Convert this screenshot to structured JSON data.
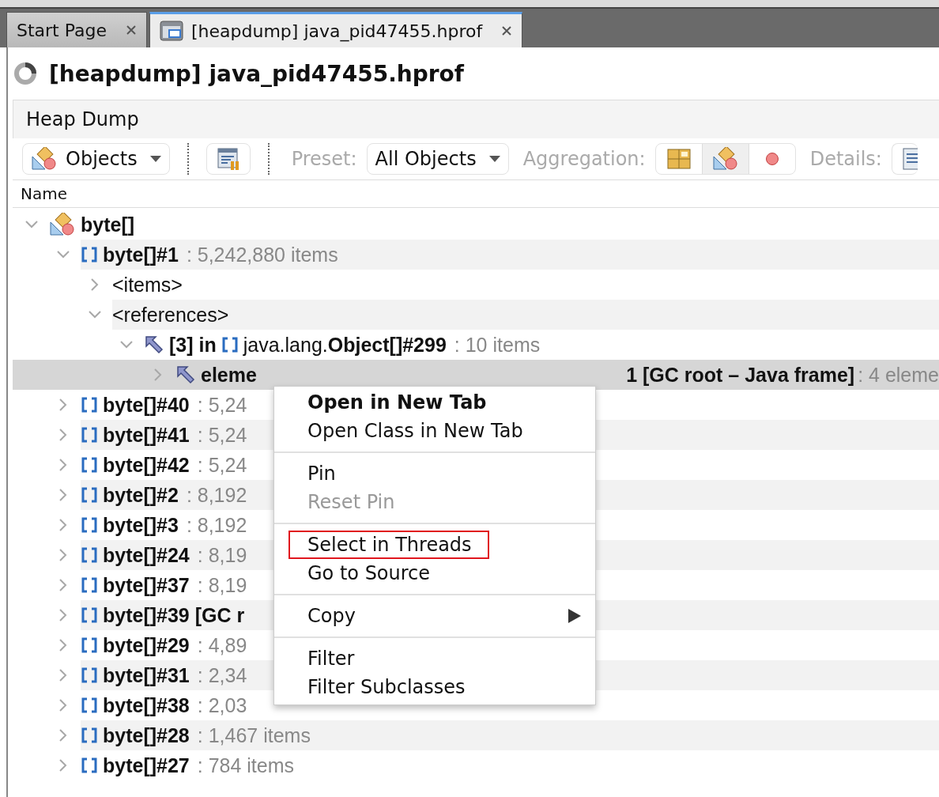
{
  "tabs": [
    {
      "label": "Start Page",
      "kind": "page",
      "selected": false
    },
    {
      "label": "[heapdump] java_pid47455.hprof",
      "kind": "heapdump",
      "selected": true
    }
  ],
  "title": "[heapdump] java_pid47455.hprof",
  "section": "Heap Dump",
  "toolbar": {
    "view": "Objects",
    "preset_label": "Preset:",
    "preset": "All Objects",
    "aggregation_label": "Aggregation:",
    "aggregation": [
      {
        "kind": "packages",
        "selected": false
      },
      {
        "kind": "classes",
        "selected": true
      },
      {
        "kind": "instances",
        "selected": false
      }
    ],
    "details_label": "Details:"
  },
  "table": {
    "columns": [
      "Name"
    ],
    "rows": [
      {
        "kind": "class",
        "name": "byte[]",
        "expanded": true,
        "selected": false,
        "children": [
          {
            "kind": "array",
            "name": "byte[]#1",
            "detail": ": 5,242,880 items",
            "expanded": true,
            "selected": false,
            "children": [
              {
                "kind": "folder",
                "name": "<items>",
                "expanded": false,
                "selected": false
              },
              {
                "kind": "folder",
                "name": "<references>",
                "expanded": true,
                "selected": false,
                "children": [
                  {
                    "kind": "reference",
                    "name": "**[3]** in",
                    "target": "java.lang.**Object[]#299**",
                    "detail": ": 10 items",
                    "expanded": true,
                    "selected": false,
                    "children": [
                      {
                        "kind": "reference",
                        "name": "**eleme**",
                        "tail": "1 [GC root – Java frame]",
                        "tail_detail": ": 4 eleme",
                        "expanded": false,
                        "selected": true
                      }
                    ]
                  }
                ]
              }
            ]
          },
          {
            "kind": "array",
            "name": "byte[]#40",
            "detail": ": 5,24",
            "expanded": false,
            "selected": false
          },
          {
            "kind": "array",
            "name": "byte[]#41",
            "detail": ": 5,24",
            "expanded": false,
            "selected": false
          },
          {
            "kind": "array",
            "name": "byte[]#42",
            "detail": ": 5,24",
            "expanded": false,
            "selected": false
          },
          {
            "kind": "array",
            "name": "byte[]#2",
            "detail": ": 8,192",
            "expanded": false,
            "selected": false
          },
          {
            "kind": "array",
            "name": "byte[]#3",
            "detail": ": 8,192",
            "expanded": false,
            "selected": false
          },
          {
            "kind": "array",
            "name": "byte[]#24",
            "detail": ": 8,19",
            "expanded": false,
            "selected": false
          },
          {
            "kind": "array",
            "name": "byte[]#37",
            "detail": ": 8,19",
            "expanded": false,
            "selected": false
          },
          {
            "kind": "array",
            "name": "byte[]#39 [GC r",
            "expanded": false,
            "selected": false
          },
          {
            "kind": "array",
            "name": "byte[]#29",
            "detail": ": 4,89",
            "expanded": false,
            "selected": false
          },
          {
            "kind": "array",
            "name": "byte[]#31",
            "detail": ": 2,34",
            "expanded": false,
            "selected": false
          },
          {
            "kind": "array",
            "name": "byte[]#38",
            "detail": ": 2,03",
            "expanded": false,
            "selected": false
          },
          {
            "kind": "array",
            "name": "byte[]#28",
            "detail": ": 1,467 items",
            "expanded": false,
            "selected": false
          },
          {
            "kind": "array",
            "name": "byte[]#27",
            "detail": ": 784 items",
            "expanded": false,
            "selected": false
          }
        ]
      }
    ]
  },
  "context_menu": {
    "groups": [
      [
        {
          "label": "Open in New Tab",
          "default": true,
          "disabled": false,
          "highlighted": false,
          "submenu": false
        },
        {
          "label": "Open Class in New Tab",
          "default": false,
          "disabled": false,
          "highlighted": false,
          "submenu": false
        }
      ],
      [
        {
          "label": "Pin",
          "default": false,
          "disabled": false,
          "highlighted": false,
          "submenu": false
        },
        {
          "label": "Reset Pin",
          "default": false,
          "disabled": true,
          "highlighted": false,
          "submenu": false
        }
      ],
      [
        {
          "label": "Select in Threads",
          "default": false,
          "disabled": false,
          "highlighted": true,
          "submenu": false
        },
        {
          "label": "Go to Source",
          "default": false,
          "disabled": false,
          "highlighted": false,
          "submenu": false
        }
      ],
      [
        {
          "label": "Copy",
          "default": false,
          "disabled": false,
          "highlighted": false,
          "submenu": true
        }
      ],
      [
        {
          "label": "Filter",
          "default": false,
          "disabled": false,
          "highlighted": false,
          "submenu": false
        },
        {
          "label": "Filter Subclasses",
          "default": false,
          "disabled": false,
          "highlighted": false,
          "submenu": false
        }
      ]
    ]
  }
}
